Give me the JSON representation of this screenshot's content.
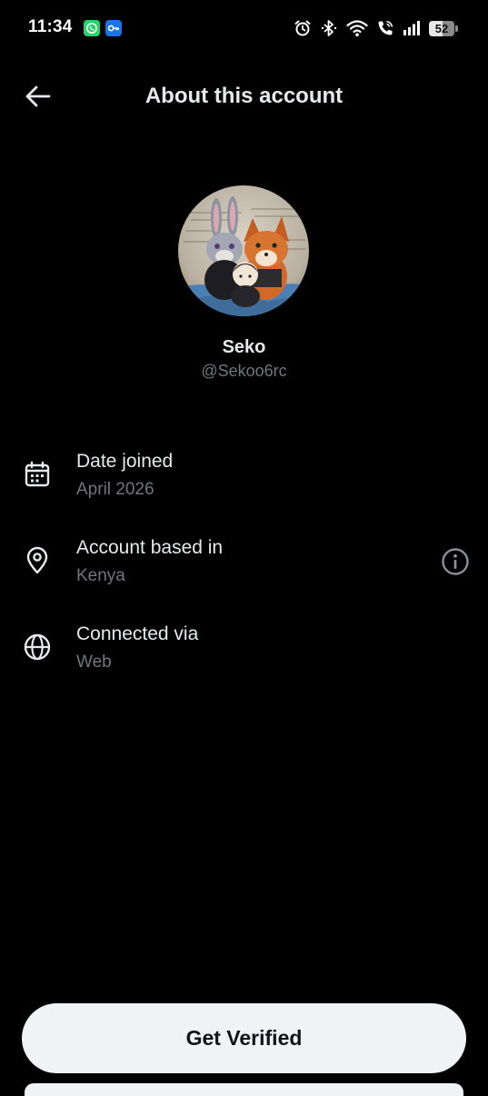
{
  "status_bar": {
    "time": "11:34",
    "notification_icons": [
      "whatsapp-icon",
      "key-icon"
    ],
    "system_icons": [
      "alarm-icon",
      "bluetooth-icon",
      "wifi-icon",
      "wifi-calling-icon",
      "signal-icon"
    ],
    "battery_level": "52",
    "battery_fraction": 0.52
  },
  "header": {
    "back_icon": "arrow-left-icon",
    "title": "About this account"
  },
  "profile": {
    "display_name": "Seko",
    "handle": "@Sekoo6rc"
  },
  "details": [
    {
      "icon": "calendar-icon",
      "label": "Date joined",
      "value": "April 2026"
    },
    {
      "icon": "location-pin-icon",
      "label": "Account based in",
      "value": "Kenya",
      "action_icon": "info-icon"
    },
    {
      "icon": "globe-icon",
      "label": "Connected via",
      "value": "Web"
    }
  ],
  "footer": {
    "button_label": "Get Verified"
  },
  "colors": {
    "background": "#000000",
    "primary_text": "#e7e9ea",
    "secondary_text": "#71767b",
    "button_background": "#eff3f4",
    "button_text": "#0f1419"
  }
}
